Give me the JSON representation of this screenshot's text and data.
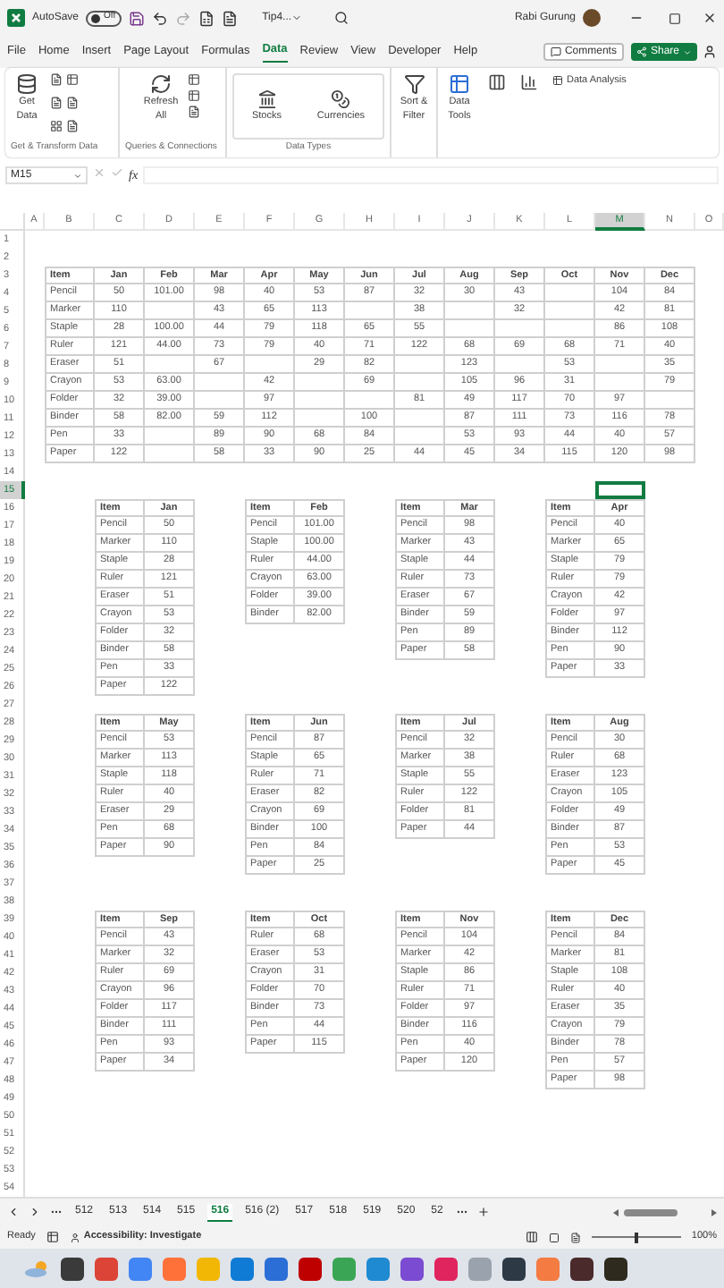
{
  "title_bar": {
    "autosave_label": "AutoSave",
    "autosave": {
      "on": false,
      "label": "Off"
    },
    "file_name": "Tip4...",
    "user": "Rabi Gurung"
  },
  "menu_tabs": [
    {
      "label": "File",
      "selected": false
    },
    {
      "label": "Home",
      "selected": false
    },
    {
      "label": "Insert",
      "selected": false
    },
    {
      "label": "Page Layout",
      "selected": false
    },
    {
      "label": "Formulas",
      "selected": false
    },
    {
      "label": "Data",
      "selected": true
    },
    {
      "label": "Review",
      "selected": false
    },
    {
      "label": "View",
      "selected": false
    },
    {
      "label": "Developer",
      "selected": false
    },
    {
      "label": "Help",
      "selected": false
    }
  ],
  "comments_button": "Comments",
  "share_button": "Share",
  "ribbon": {
    "groups": [
      {
        "caption": "Get & Transform Data",
        "buttons": [
          "Get Data"
        ]
      },
      {
        "caption": "Queries & Connections",
        "buttons": [
          "Refresh All"
        ]
      },
      {
        "caption": "Data Types",
        "buttons": [
          "Stocks",
          "Currencies"
        ]
      }
    ],
    "sort_filter": "Sort & Filter",
    "data_tools": "Data Tools",
    "data_analysis": "Data Analysis"
  },
  "formula_bar": {
    "name_box": "M15",
    "fx": "fx"
  },
  "sheet": {
    "columns": [
      {
        "label": "A",
        "selected": false
      },
      {
        "label": "B",
        "selected": false
      },
      {
        "label": "C",
        "selected": false
      },
      {
        "label": "D",
        "selected": false
      },
      {
        "label": "E",
        "selected": false
      },
      {
        "label": "F",
        "selected": false
      },
      {
        "label": "G",
        "selected": false
      },
      {
        "label": "H",
        "selected": false
      },
      {
        "label": "I",
        "selected": false
      },
      {
        "label": "J",
        "selected": false
      },
      {
        "label": "K",
        "selected": false
      },
      {
        "label": "L",
        "selected": false
      },
      {
        "label": "M",
        "selected": true
      },
      {
        "label": "N",
        "selected": false
      },
      {
        "label": "O",
        "selected": false
      }
    ],
    "rows": [
      {
        "label": "1",
        "selected": false
      },
      {
        "label": "2",
        "selected": false
      },
      {
        "label": "3",
        "selected": false
      },
      {
        "label": "4",
        "selected": false
      },
      {
        "label": "5",
        "selected": false
      },
      {
        "label": "6",
        "selected": false
      },
      {
        "label": "7",
        "selected": false
      },
      {
        "label": "8",
        "selected": false
      },
      {
        "label": "9",
        "selected": false
      },
      {
        "label": "10",
        "selected": false
      },
      {
        "label": "11",
        "selected": false
      },
      {
        "label": "12",
        "selected": false
      },
      {
        "label": "13",
        "selected": false
      },
      {
        "label": "14",
        "selected": false
      },
      {
        "label": "15",
        "selected": true
      },
      {
        "label": "16",
        "selected": false
      },
      {
        "label": "17",
        "selected": false
      },
      {
        "label": "18",
        "selected": false
      },
      {
        "label": "19",
        "selected": false
      },
      {
        "label": "20",
        "selected": false
      },
      {
        "label": "21",
        "selected": false
      },
      {
        "label": "22",
        "selected": false
      },
      {
        "label": "23",
        "selected": false
      },
      {
        "label": "24",
        "selected": false
      },
      {
        "label": "25",
        "selected": false
      },
      {
        "label": "26",
        "selected": false
      },
      {
        "label": "27",
        "selected": false
      },
      {
        "label": "28",
        "selected": false
      },
      {
        "label": "29",
        "selected": false
      },
      {
        "label": "30",
        "selected": false
      },
      {
        "label": "31",
        "selected": false
      },
      {
        "label": "32",
        "selected": false
      },
      {
        "label": "33",
        "selected": false
      },
      {
        "label": "34",
        "selected": false
      },
      {
        "label": "35",
        "selected": false
      },
      {
        "label": "36",
        "selected": false
      },
      {
        "label": "37",
        "selected": false
      },
      {
        "label": "38",
        "selected": false
      },
      {
        "label": "39",
        "selected": false
      },
      {
        "label": "40",
        "selected": false
      },
      {
        "label": "41",
        "selected": false
      },
      {
        "label": "42",
        "selected": false
      },
      {
        "label": "43",
        "selected": false
      },
      {
        "label": "44",
        "selected": false
      },
      {
        "label": "45",
        "selected": false
      },
      {
        "label": "46",
        "selected": false
      },
      {
        "label": "47",
        "selected": false
      },
      {
        "label": "48",
        "selected": false
      },
      {
        "label": "49",
        "selected": false
      },
      {
        "label": "50",
        "selected": false
      },
      {
        "label": "51",
        "selected": false
      },
      {
        "label": "52",
        "selected": false
      },
      {
        "label": "53",
        "selected": false
      },
      {
        "label": "54",
        "selected": false
      }
    ],
    "summary_table": {
      "columns": [
        "Item",
        "Jan",
        "Feb",
        "Mar",
        "Apr",
        "May",
        "Jun",
        "Jul",
        "Aug",
        "Sep",
        "Oct",
        "Nov",
        "Dec"
      ],
      "rows": [
        {
          "item": "Pencil",
          "values": [
            {
              "kind": "number",
              "value": "50"
            },
            {
              "kind": "number",
              "value": "101.00"
            },
            {
              "kind": "number",
              "value": "98"
            },
            {
              "kind": "number",
              "value": "40"
            },
            {
              "kind": "number",
              "value": "53"
            },
            {
              "kind": "number",
              "value": "87"
            },
            {
              "kind": "number",
              "value": "32"
            },
            {
              "kind": "number",
              "value": "30"
            },
            {
              "kind": "number",
              "value": "43"
            },
            {
              "kind": "blank"
            },
            {
              "kind": "number",
              "value": "104"
            },
            {
              "kind": "number",
              "value": "84"
            }
          ]
        },
        {
          "item": "Marker",
          "values": [
            {
              "kind": "number",
              "value": "110"
            },
            {
              "kind": "blank"
            },
            {
              "kind": "number",
              "value": "43"
            },
            {
              "kind": "number",
              "value": "65"
            },
            {
              "kind": "number",
              "value": "113"
            },
            {
              "kind": "blank"
            },
            {
              "kind": "number",
              "value": "38"
            },
            {
              "kind": "blank"
            },
            {
              "kind": "number",
              "value": "32"
            },
            {
              "kind": "blank"
            },
            {
              "kind": "number",
              "value": "42"
            },
            {
              "kind": "number",
              "value": "81"
            }
          ]
        },
        {
          "item": "Staple",
          "values": [
            {
              "kind": "number",
              "value": "28"
            },
            {
              "kind": "number",
              "value": "100.00"
            },
            {
              "kind": "number",
              "value": "44"
            },
            {
              "kind": "number",
              "value": "79"
            },
            {
              "kind": "number",
              "value": "118"
            },
            {
              "kind": "number",
              "value": "65"
            },
            {
              "kind": "number",
              "value": "55"
            },
            {
              "kind": "blank"
            },
            {
              "kind": "blank"
            },
            {
              "kind": "blank"
            },
            {
              "kind": "number",
              "value": "86"
            },
            {
              "kind": "number",
              "value": "108"
            }
          ]
        },
        {
          "item": "Ruler",
          "values": [
            {
              "kind": "number",
              "value": "121"
            },
            {
              "kind": "number",
              "value": "44.00"
            },
            {
              "kind": "number",
              "value": "73"
            },
            {
              "kind": "number",
              "value": "79"
            },
            {
              "kind": "number",
              "value": "40"
            },
            {
              "kind": "number",
              "value": "71"
            },
            {
              "kind": "number",
              "value": "122"
            },
            {
              "kind": "number",
              "value": "68"
            },
            {
              "kind": "number",
              "value": "69"
            },
            {
              "kind": "number",
              "value": "68"
            },
            {
              "kind": "number",
              "value": "71"
            },
            {
              "kind": "number",
              "value": "40"
            }
          ]
        },
        {
          "item": "Eraser",
          "values": [
            {
              "kind": "number",
              "value": "51"
            },
            {
              "kind": "blank"
            },
            {
              "kind": "number",
              "value": "67"
            },
            {
              "kind": "blank"
            },
            {
              "kind": "number",
              "value": "29"
            },
            {
              "kind": "number",
              "value": "82"
            },
            {
              "kind": "blank"
            },
            {
              "kind": "number",
              "value": "123"
            },
            {
              "kind": "blank"
            },
            {
              "kind": "number",
              "value": "53"
            },
            {
              "kind": "blank"
            },
            {
              "kind": "number",
              "value": "35"
            }
          ]
        },
        {
          "item": "Crayon",
          "values": [
            {
              "kind": "number",
              "value": "53"
            },
            {
              "kind": "number",
              "value": "63.00"
            },
            {
              "kind": "blank"
            },
            {
              "kind": "number",
              "value": "42"
            },
            {
              "kind": "blank"
            },
            {
              "kind": "number",
              "value": "69"
            },
            {
              "kind": "blank"
            },
            {
              "kind": "number",
              "value": "105"
            },
            {
              "kind": "number",
              "value": "96"
            },
            {
              "kind": "number",
              "value": "31"
            },
            {
              "kind": "blank"
            },
            {
              "kind": "number",
              "value": "79"
            }
          ]
        },
        {
          "item": "Folder",
          "values": [
            {
              "kind": "number",
              "value": "32"
            },
            {
              "kind": "number",
              "value": "39.00"
            },
            {
              "kind": "blank"
            },
            {
              "kind": "number",
              "value": "97"
            },
            {
              "kind": "blank"
            },
            {
              "kind": "blank"
            },
            {
              "kind": "number",
              "value": "81"
            },
            {
              "kind": "number",
              "value": "49"
            },
            {
              "kind": "number",
              "value": "117"
            },
            {
              "kind": "number",
              "value": "70"
            },
            {
              "kind": "number",
              "value": "97"
            },
            {
              "kind": "blank"
            }
          ]
        },
        {
          "item": "Binder",
          "values": [
            {
              "kind": "number",
              "value": "58"
            },
            {
              "kind": "number",
              "value": "82.00"
            },
            {
              "kind": "number",
              "value": "59"
            },
            {
              "kind": "number",
              "value": "112"
            },
            {
              "kind": "blank"
            },
            {
              "kind": "number",
              "value": "100"
            },
            {
              "kind": "blank"
            },
            {
              "kind": "number",
              "value": "87"
            },
            {
              "kind": "number",
              "value": "111"
            },
            {
              "kind": "number",
              "value": "73"
            },
            {
              "kind": "number",
              "value": "116"
            },
            {
              "kind": "number",
              "value": "78"
            }
          ]
        },
        {
          "item": "Pen",
          "values": [
            {
              "kind": "number",
              "value": "33"
            },
            {
              "kind": "blank"
            },
            {
              "kind": "number",
              "value": "89"
            },
            {
              "kind": "number",
              "value": "90"
            },
            {
              "kind": "number",
              "value": "68"
            },
            {
              "kind": "number",
              "value": "84"
            },
            {
              "kind": "blank"
            },
            {
              "kind": "number",
              "value": "53"
            },
            {
              "kind": "number",
              "value": "93"
            },
            {
              "kind": "number",
              "value": "44"
            },
            {
              "kind": "number",
              "value": "40"
            },
            {
              "kind": "number",
              "value": "57"
            }
          ]
        },
        {
          "item": "Paper",
          "values": [
            {
              "kind": "number",
              "value": "122"
            },
            {
              "kind": "blank"
            },
            {
              "kind": "number",
              "value": "58"
            },
            {
              "kind": "number",
              "value": "33"
            },
            {
              "kind": "number",
              "value": "90"
            },
            {
              "kind": "number",
              "value": "25"
            },
            {
              "kind": "number",
              "value": "44"
            },
            {
              "kind": "number",
              "value": "45"
            },
            {
              "kind": "number",
              "value": "34"
            },
            {
              "kind": "number",
              "value": "115"
            },
            {
              "kind": "number",
              "value": "120"
            },
            {
              "kind": "number",
              "value": "98"
            }
          ]
        }
      ]
    },
    "month_tables": [
      {
        "columns": [
          "Item",
          "Jan"
        ],
        "rows": [
          {
            "item": "Pencil",
            "value": "50"
          },
          {
            "item": "Marker",
            "value": "110"
          },
          {
            "item": "Staple",
            "value": "28"
          },
          {
            "item": "Ruler",
            "value": "121"
          },
          {
            "item": "Eraser",
            "value": "51"
          },
          {
            "item": "Crayon",
            "value": "53"
          },
          {
            "item": "Folder",
            "value": "32"
          },
          {
            "item": "Binder",
            "value": "58"
          },
          {
            "item": "Pen",
            "value": "33"
          },
          {
            "item": "Paper",
            "value": "122"
          }
        ]
      },
      {
        "columns": [
          "Item",
          "Feb"
        ],
        "rows": [
          {
            "item": "Pencil",
            "value": "101.00"
          },
          {
            "item": "Staple",
            "value": "100.00"
          },
          {
            "item": "Ruler",
            "value": "44.00"
          },
          {
            "item": "Crayon",
            "value": "63.00"
          },
          {
            "item": "Folder",
            "value": "39.00"
          },
          {
            "item": "Binder",
            "value": "82.00"
          }
        ]
      },
      {
        "columns": [
          "Item",
          "Mar"
        ],
        "rows": [
          {
            "item": "Pencil",
            "value": "98"
          },
          {
            "item": "Marker",
            "value": "43"
          },
          {
            "item": "Staple",
            "value": "44"
          },
          {
            "item": "Ruler",
            "value": "73"
          },
          {
            "item": "Eraser",
            "value": "67"
          },
          {
            "item": "Binder",
            "value": "59"
          },
          {
            "item": "Pen",
            "value": "89"
          },
          {
            "item": "Paper",
            "value": "58"
          }
        ]
      },
      {
        "columns": [
          "Item",
          "Apr"
        ],
        "rows": [
          {
            "item": "Pencil",
            "value": "40"
          },
          {
            "item": "Marker",
            "value": "65"
          },
          {
            "item": "Staple",
            "value": "79"
          },
          {
            "item": "Ruler",
            "value": "79"
          },
          {
            "item": "Crayon",
            "value": "42"
          },
          {
            "item": "Folder",
            "value": "97"
          },
          {
            "item": "Binder",
            "value": "112"
          },
          {
            "item": "Pen",
            "value": "90"
          },
          {
            "item": "Paper",
            "value": "33"
          }
        ]
      },
      {
        "columns": [
          "Item",
          "May"
        ],
        "rows": [
          {
            "item": "Pencil",
            "value": "53"
          },
          {
            "item": "Marker",
            "value": "113"
          },
          {
            "item": "Staple",
            "value": "118"
          },
          {
            "item": "Ruler",
            "value": "40"
          },
          {
            "item": "Eraser",
            "value": "29"
          },
          {
            "item": "Pen",
            "value": "68"
          },
          {
            "item": "Paper",
            "value": "90"
          }
        ]
      },
      {
        "columns": [
          "Item",
          "Jun"
        ],
        "rows": [
          {
            "item": "Pencil",
            "value": "87"
          },
          {
            "item": "Staple",
            "value": "65"
          },
          {
            "item": "Ruler",
            "value": "71"
          },
          {
            "item": "Eraser",
            "value": "82"
          },
          {
            "item": "Crayon",
            "value": "69"
          },
          {
            "item": "Binder",
            "value": "100"
          },
          {
            "item": "Pen",
            "value": "84"
          },
          {
            "item": "Paper",
            "value": "25"
          }
        ]
      },
      {
        "columns": [
          "Item",
          "Jul"
        ],
        "rows": [
          {
            "item": "Pencil",
            "value": "32"
          },
          {
            "item": "Marker",
            "value": "38"
          },
          {
            "item": "Staple",
            "value": "55"
          },
          {
            "item": "Ruler",
            "value": "122"
          },
          {
            "item": "Folder",
            "value": "81"
          },
          {
            "item": "Paper",
            "value": "44"
          }
        ]
      },
      {
        "columns": [
          "Item",
          "Aug"
        ],
        "rows": [
          {
            "item": "Pencil",
            "value": "30"
          },
          {
            "item": "Ruler",
            "value": "68"
          },
          {
            "item": "Eraser",
            "value": "123"
          },
          {
            "item": "Crayon",
            "value": "105"
          },
          {
            "item": "Folder",
            "value": "49"
          },
          {
            "item": "Binder",
            "value": "87"
          },
          {
            "item": "Pen",
            "value": "53"
          },
          {
            "item": "Paper",
            "value": "45"
          }
        ]
      },
      {
        "columns": [
          "Item",
          "Sep"
        ],
        "rows": [
          {
            "item": "Pencil",
            "value": "43"
          },
          {
            "item": "Marker",
            "value": "32"
          },
          {
            "item": "Ruler",
            "value": "69"
          },
          {
            "item": "Crayon",
            "value": "96"
          },
          {
            "item": "Folder",
            "value": "117"
          },
          {
            "item": "Binder",
            "value": "111"
          },
          {
            "item": "Pen",
            "value": "93"
          },
          {
            "item": "Paper",
            "value": "34"
          }
        ]
      },
      {
        "columns": [
          "Item",
          "Oct"
        ],
        "rows": [
          {
            "item": "Ruler",
            "value": "68"
          },
          {
            "item": "Eraser",
            "value": "53"
          },
          {
            "item": "Crayon",
            "value": "31"
          },
          {
            "item": "Folder",
            "value": "70"
          },
          {
            "item": "Binder",
            "value": "73"
          },
          {
            "item": "Pen",
            "value": "44"
          },
          {
            "item": "Paper",
            "value": "115"
          }
        ]
      },
      {
        "columns": [
          "Item",
          "Nov"
        ],
        "rows": [
          {
            "item": "Pencil",
            "value": "104"
          },
          {
            "item": "Marker",
            "value": "42"
          },
          {
            "item": "Staple",
            "value": "86"
          },
          {
            "item": "Ruler",
            "value": "71"
          },
          {
            "item": "Folder",
            "value": "97"
          },
          {
            "item": "Binder",
            "value": "116"
          },
          {
            "item": "Pen",
            "value": "40"
          },
          {
            "item": "Paper",
            "value": "120"
          }
        ]
      },
      {
        "columns": [
          "Item",
          "Dec"
        ],
        "rows": [
          {
            "item": "Pencil",
            "value": "84"
          },
          {
            "item": "Marker",
            "value": "81"
          },
          {
            "item": "Staple",
            "value": "108"
          },
          {
            "item": "Ruler",
            "value": "40"
          },
          {
            "item": "Eraser",
            "value": "35"
          },
          {
            "item": "Crayon",
            "value": "79"
          },
          {
            "item": "Binder",
            "value": "78"
          },
          {
            "item": "Pen",
            "value": "57"
          },
          {
            "item": "Paper",
            "value": "98"
          }
        ]
      }
    ]
  },
  "sheet_tabs": [
    {
      "label": "512",
      "selected": false
    },
    {
      "label": "513",
      "selected": false
    },
    {
      "label": "514",
      "selected": false
    },
    {
      "label": "515",
      "selected": false
    },
    {
      "label": "516",
      "selected": true
    },
    {
      "label": "516 (2)",
      "selected": false
    },
    {
      "label": "517",
      "selected": false
    },
    {
      "label": "518",
      "selected": false
    },
    {
      "label": "519",
      "selected": false
    },
    {
      "label": "520",
      "selected": false
    },
    {
      "label": "52",
      "selected": false
    }
  ],
  "status_bar": {
    "ready": "Ready",
    "accessibility": "Accessibility: Investigate",
    "zoom": {
      "level": 0.5
    },
    "zoom_text": "100%"
  }
}
